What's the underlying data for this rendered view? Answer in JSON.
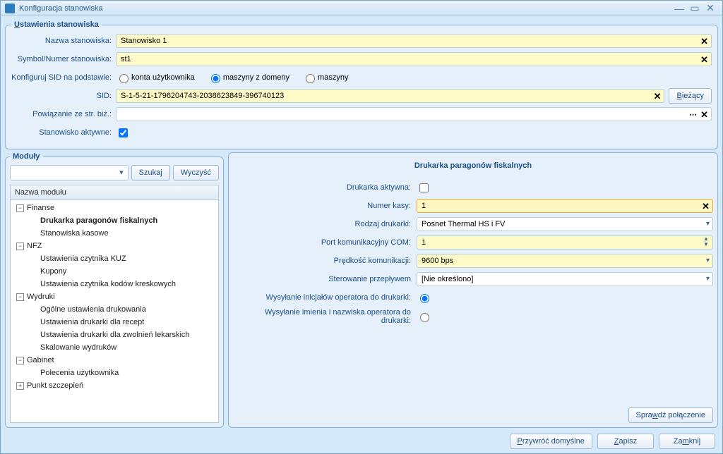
{
  "window": {
    "title": "Konfiguracja stanowiska"
  },
  "settings": {
    "legend": "Ustawienia stanowiska",
    "labels": {
      "nazwa": "Nazwa stanowiska:",
      "symbol": "Symbol/Numer stanowiska:",
      "konfig": "Konfiguruj SID na podstawie:",
      "sid": "SID:",
      "powiaz": "Powiązanie ze str. biz.:",
      "aktywne": "Stanowisko aktywne:"
    },
    "values": {
      "nazwa": "Stanowisko 1",
      "symbol": "st1",
      "sid": "S-1-5-21-1796204743-2038623849-396740123",
      "powiaz": ""
    },
    "radios": {
      "r1": "konta użytkownika",
      "r2": "maszyny z domeny",
      "r3": "maszyny"
    },
    "buttons": {
      "biezacy": "Bieżący"
    }
  },
  "modules": {
    "legend": "Moduły",
    "buttons": {
      "szukaj": "Szukaj",
      "wyczysc": "Wyczyść"
    },
    "header": "Nazwa modułu",
    "tree": {
      "finanse": "Finanse",
      "drukarka": "Drukarka paragonów fiskalnych",
      "kasowe": "Stanowiska kasowe",
      "nfz": "NFZ",
      "kuz": "Ustawienia czytnika KUZ",
      "kupony": "Kupony",
      "kody": "Ustawienia czytnika kodów kreskowych",
      "wydruki": "Wydruki",
      "ogolne": "Ogólne ustawienia drukowania",
      "recept": "Ustawienia drukarki dla recept",
      "zwolnien": "Ustawienia drukarki dla zwolnień lekarskich",
      "skalowanie": "Skalowanie wydruków",
      "gabinet": "Gabinet",
      "polecenia": "Polecenia użytkownika",
      "szczepien": "Punkt szczepień"
    }
  },
  "panel": {
    "title": "Drukarka paragonów fiskalnych",
    "labels": {
      "aktywna": "Drukarka aktywna:",
      "numer": "Numer kasy:",
      "rodzaj": "Rodzaj drukarki:",
      "port": "Port komunikacyjny COM:",
      "predkosc": "Prędkość komunikacji:",
      "sterowanie": "Sterowanie przepływem",
      "inicjaly": "Wysyłanie inicjałów operatora do drukarki:",
      "imienia": "Wysyłanie imienia i nazwiska operatora do drukarki:"
    },
    "values": {
      "numer": "1",
      "rodzaj": "Posnet Thermal HS i FV",
      "port": "1",
      "predkosc": "9600 bps",
      "sterowanie": "[Nie określono]"
    },
    "buttons": {
      "sprawdz": "Sprawdź połączenie"
    }
  },
  "footer": {
    "przywroc": "Przywróć domyślne",
    "zapisz": "Zapisz",
    "zamknij": "Zamknij"
  }
}
